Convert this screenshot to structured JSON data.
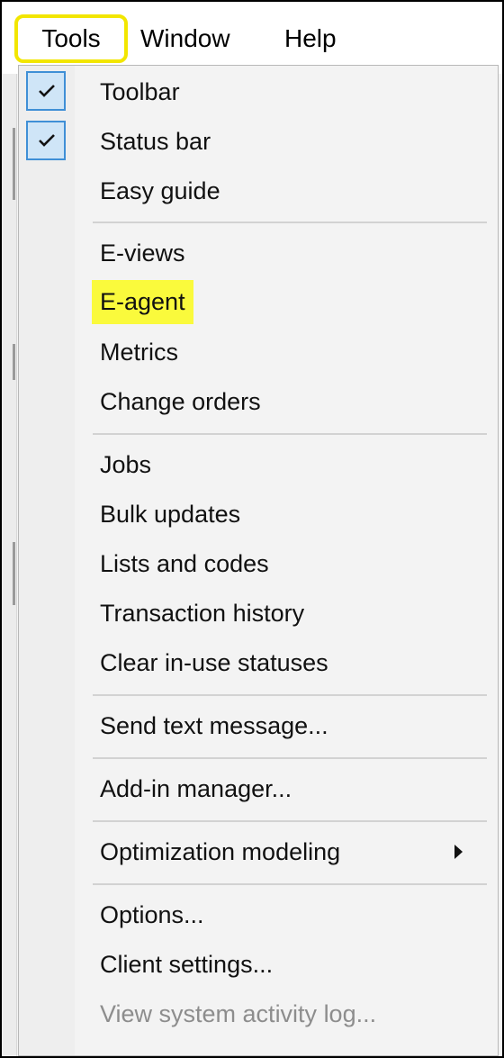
{
  "menubar": {
    "tools": "Tools",
    "window": "Window",
    "help": "Help"
  },
  "menu": {
    "items": [
      {
        "label": "Toolbar",
        "checked": true
      },
      {
        "label": "Status bar",
        "checked": true
      },
      {
        "label": "Easy guide"
      },
      {
        "label": "E-views"
      },
      {
        "label": "E-agent",
        "highlighted": true
      },
      {
        "label": "Metrics"
      },
      {
        "label": "Change orders"
      },
      {
        "label": "Jobs"
      },
      {
        "label": "Bulk updates"
      },
      {
        "label": "Lists and codes"
      },
      {
        "label": "Transaction history"
      },
      {
        "label": "Clear in-use statuses"
      },
      {
        "label": "Send text message..."
      },
      {
        "label": "Add-in manager..."
      },
      {
        "label": "Optimization modeling",
        "submenu": true
      },
      {
        "label": "Options..."
      },
      {
        "label": "Client settings..."
      },
      {
        "label": "View system activity log...",
        "disabled": true
      }
    ]
  },
  "colors": {
    "highlight": "#fafa3c",
    "tools_outline": "#f2e600",
    "check_border": "#3f8fd6",
    "check_fill": "#cfe5f7"
  }
}
